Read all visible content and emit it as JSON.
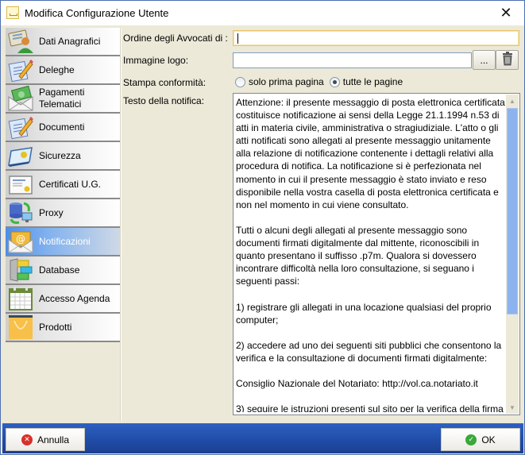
{
  "window": {
    "title": "Modifica Configurazione Utente",
    "close_icon": "close-icon"
  },
  "sidebar": {
    "items": [
      {
        "label": "Dati Anagrafici",
        "icon": "user-card-icon",
        "active": false
      },
      {
        "label": "Deleghe",
        "icon": "document-pencil-icon",
        "active": false
      },
      {
        "label": "Pagamenti\nTelematici",
        "icon": "money-envelope-icon",
        "active": false
      },
      {
        "label": "Documenti",
        "icon": "document-pencil-icon",
        "active": false
      },
      {
        "label": "Sicurezza",
        "icon": "security-card-icon",
        "active": false
      },
      {
        "label": "Certificati U.G.",
        "icon": "certificate-icon",
        "active": false
      },
      {
        "label": "Proxy",
        "icon": "proxy-network-icon",
        "active": false
      },
      {
        "label": "Notificazioni",
        "icon": "email-at-icon",
        "active": true
      },
      {
        "label": "Database",
        "icon": "database-drawers-icon",
        "active": false
      },
      {
        "label": "Accesso Agenda",
        "icon": "calendar-icon",
        "active": false
      },
      {
        "label": "Prodotti",
        "icon": "shopping-bag-icon",
        "active": false
      }
    ]
  },
  "form": {
    "ordine_label": "Ordine degli Avvocati di :",
    "ordine_value": "",
    "logo_label": "Immagine logo:",
    "logo_value": "",
    "browse_label": "...",
    "delete_icon": "trash-icon",
    "stampa_label": "Stampa conformità:",
    "stampa_options": [
      {
        "label": "solo prima pagina",
        "checked": false
      },
      {
        "label": "tutte le pagine",
        "checked": true
      }
    ],
    "testo_label": "Testo della notifica:",
    "testo_value": "Attenzione: il presente messaggio di posta elettronica certificata costituisce notificazione ai sensi della Legge 21.1.1994 n.53 di atti in materia civile, amministrativa o stragiudiziale. L'atto o gli atti notificati sono allegati al presente messaggio unitamente alla relazione di notificazione contenente i dettagli relativi alla procedura di notifica. La notificazione si è perfezionata nel momento in cui il presente messaggio è stato inviato e reso disponibile nella vostra casella di posta elettronica certificata e non nel momento in cui viene consultato.\n\nTutti o alcuni degli allegati al presente messaggio sono documenti firmati digitalmente dal mittente, riconoscibili in quanto presentano il suffisso .p7m. Qualora si dovessero incontrare difficoltà nella loro consultazione, si seguano i seguenti passi:\n\n1) registrare gli allegati in una locazione qualsiasi del proprio computer;\n\n2) accedere ad uno dei seguenti siti pubblici che consentono la verifica e la consultazione di documenti firmati digitalmente:\n\nConsiglio Nazionale del Notariato: http://vol.ca.notariato.it\n\n3) seguire le istruzioni presenti sul sito per la verifica della firma",
    "scroll_position": 0
  },
  "footer": {
    "cancel_label": "Annulla",
    "ok_label": "OK"
  },
  "colors": {
    "accent_blue": "#2d5fc0",
    "active_nav": "#4d8ee6",
    "focus_border": "#e8c56a",
    "scroll_thumb": "#8db3ee"
  }
}
